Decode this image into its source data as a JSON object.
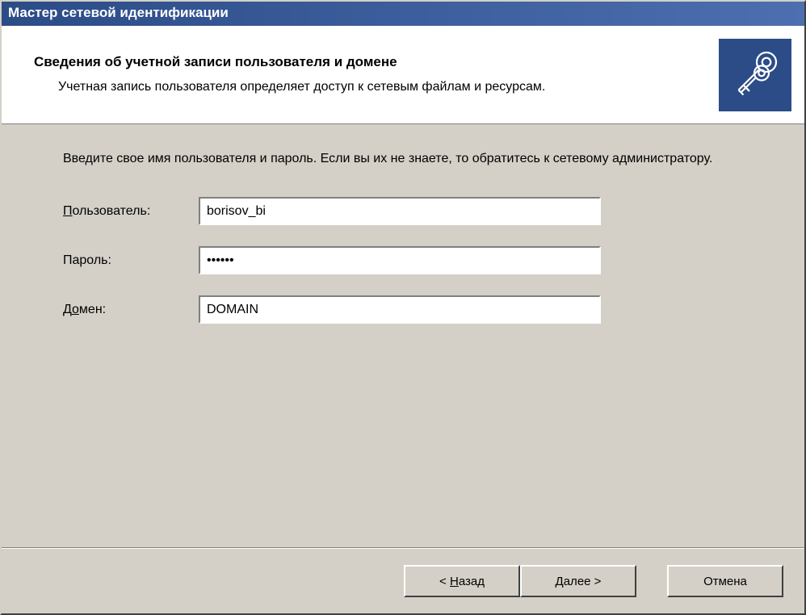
{
  "titlebar": {
    "title": "Мастер сетевой идентификации"
  },
  "header": {
    "title": "Сведения об учетной записи пользователя и домене",
    "subtitle": "Учетная запись пользователя определяет доступ к сетевым файлам и ресурсам."
  },
  "content": {
    "instructions": "Введите свое имя пользователя и пароль. Если вы их не знаете, то обратитесь к сетевому администратору."
  },
  "form": {
    "user_label_prefix": "П",
    "user_label_rest": "ользователь:",
    "user_value": "borisov_bi",
    "password_label": "Пароль:",
    "password_value": "••••••",
    "domain_label_prefix": "Д",
    "domain_label_mid": "о",
    "domain_label_suffix": "мен:",
    "domain_value": "DOMAIN"
  },
  "buttons": {
    "back_prefix": "< ",
    "back_u": "Н",
    "back_rest": "азад",
    "next_u": "Д",
    "next_rest": "алее >",
    "cancel": "Отмена"
  }
}
